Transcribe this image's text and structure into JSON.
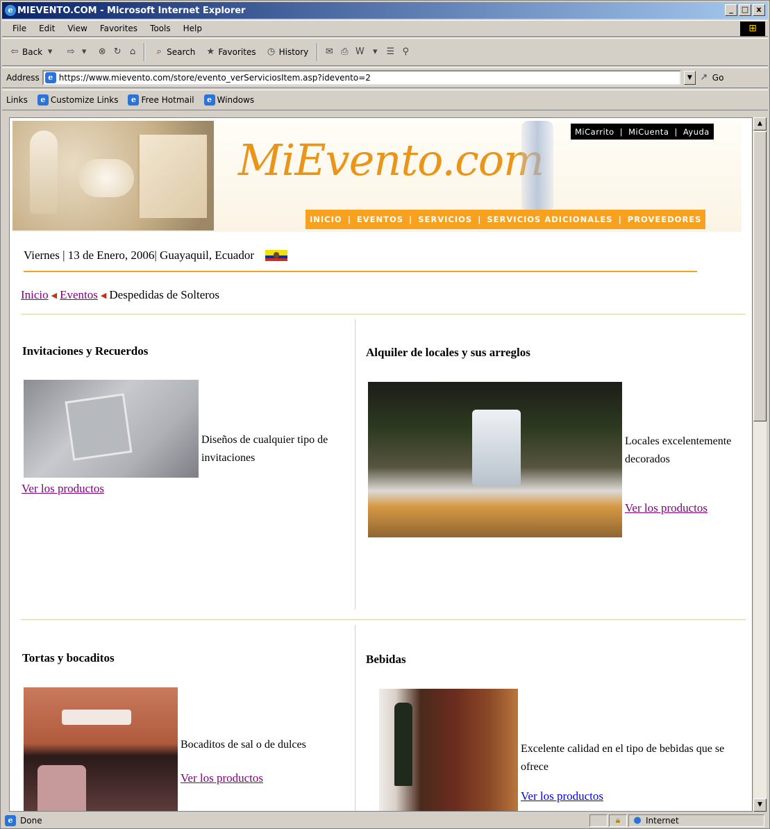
{
  "window": {
    "title": "MIEVENTO.COM - Microsoft Internet Explorer",
    "min": "_",
    "max": "□",
    "close": "x"
  },
  "menu": [
    "File",
    "Edit",
    "View",
    "Favorites",
    "Tools",
    "Help"
  ],
  "toolbar": {
    "back": "Back",
    "search": "Search",
    "favorites": "Favorites",
    "history": "History"
  },
  "address": {
    "label": "Address",
    "url": "https://www.mievento.com/store/evento_verServiciosItem.asp?idevento=2",
    "go": "Go"
  },
  "links": {
    "label": "Links",
    "items": [
      "Customize Links",
      "Free Hotmail",
      "Windows"
    ]
  },
  "status": {
    "text": "Done",
    "zone": "Internet"
  },
  "page": {
    "logo": "MiEvento.com",
    "topnav": [
      "MiCarrito",
      "|",
      "MiCuenta",
      "|",
      "Ayuda"
    ],
    "mainnav": [
      "INICIO",
      "|",
      "EVENTOS",
      "|",
      "SERVICIOS",
      "|",
      "SERVICIOS ADICIONALES",
      "|",
      "PROVEEDORES"
    ],
    "date": "Viernes | 13 de Enero, 2006| Guayaquil, Ecuador",
    "breadcrumb": {
      "home": "Inicio",
      "events": "Eventos",
      "current": "Despedidas de Solteros"
    },
    "services": [
      {
        "title": "Invitaciones y Recuerdos",
        "desc": "Diseños de cualquier tipo de invitaciones",
        "link": "Ver los productos"
      },
      {
        "title": "Alquiler de locales y sus arreglos",
        "desc": "Locales excelentemente decorados",
        "link": "Ver los productos"
      },
      {
        "title": "Tortas y bocaditos",
        "desc": "Bocaditos de sal o de dulces",
        "link": "Ver los productos"
      },
      {
        "title": "Bebidas",
        "desc": "Excelente calidad en el tipo de bebidas que se ofrece",
        "link": "Ver los productos"
      }
    ]
  }
}
